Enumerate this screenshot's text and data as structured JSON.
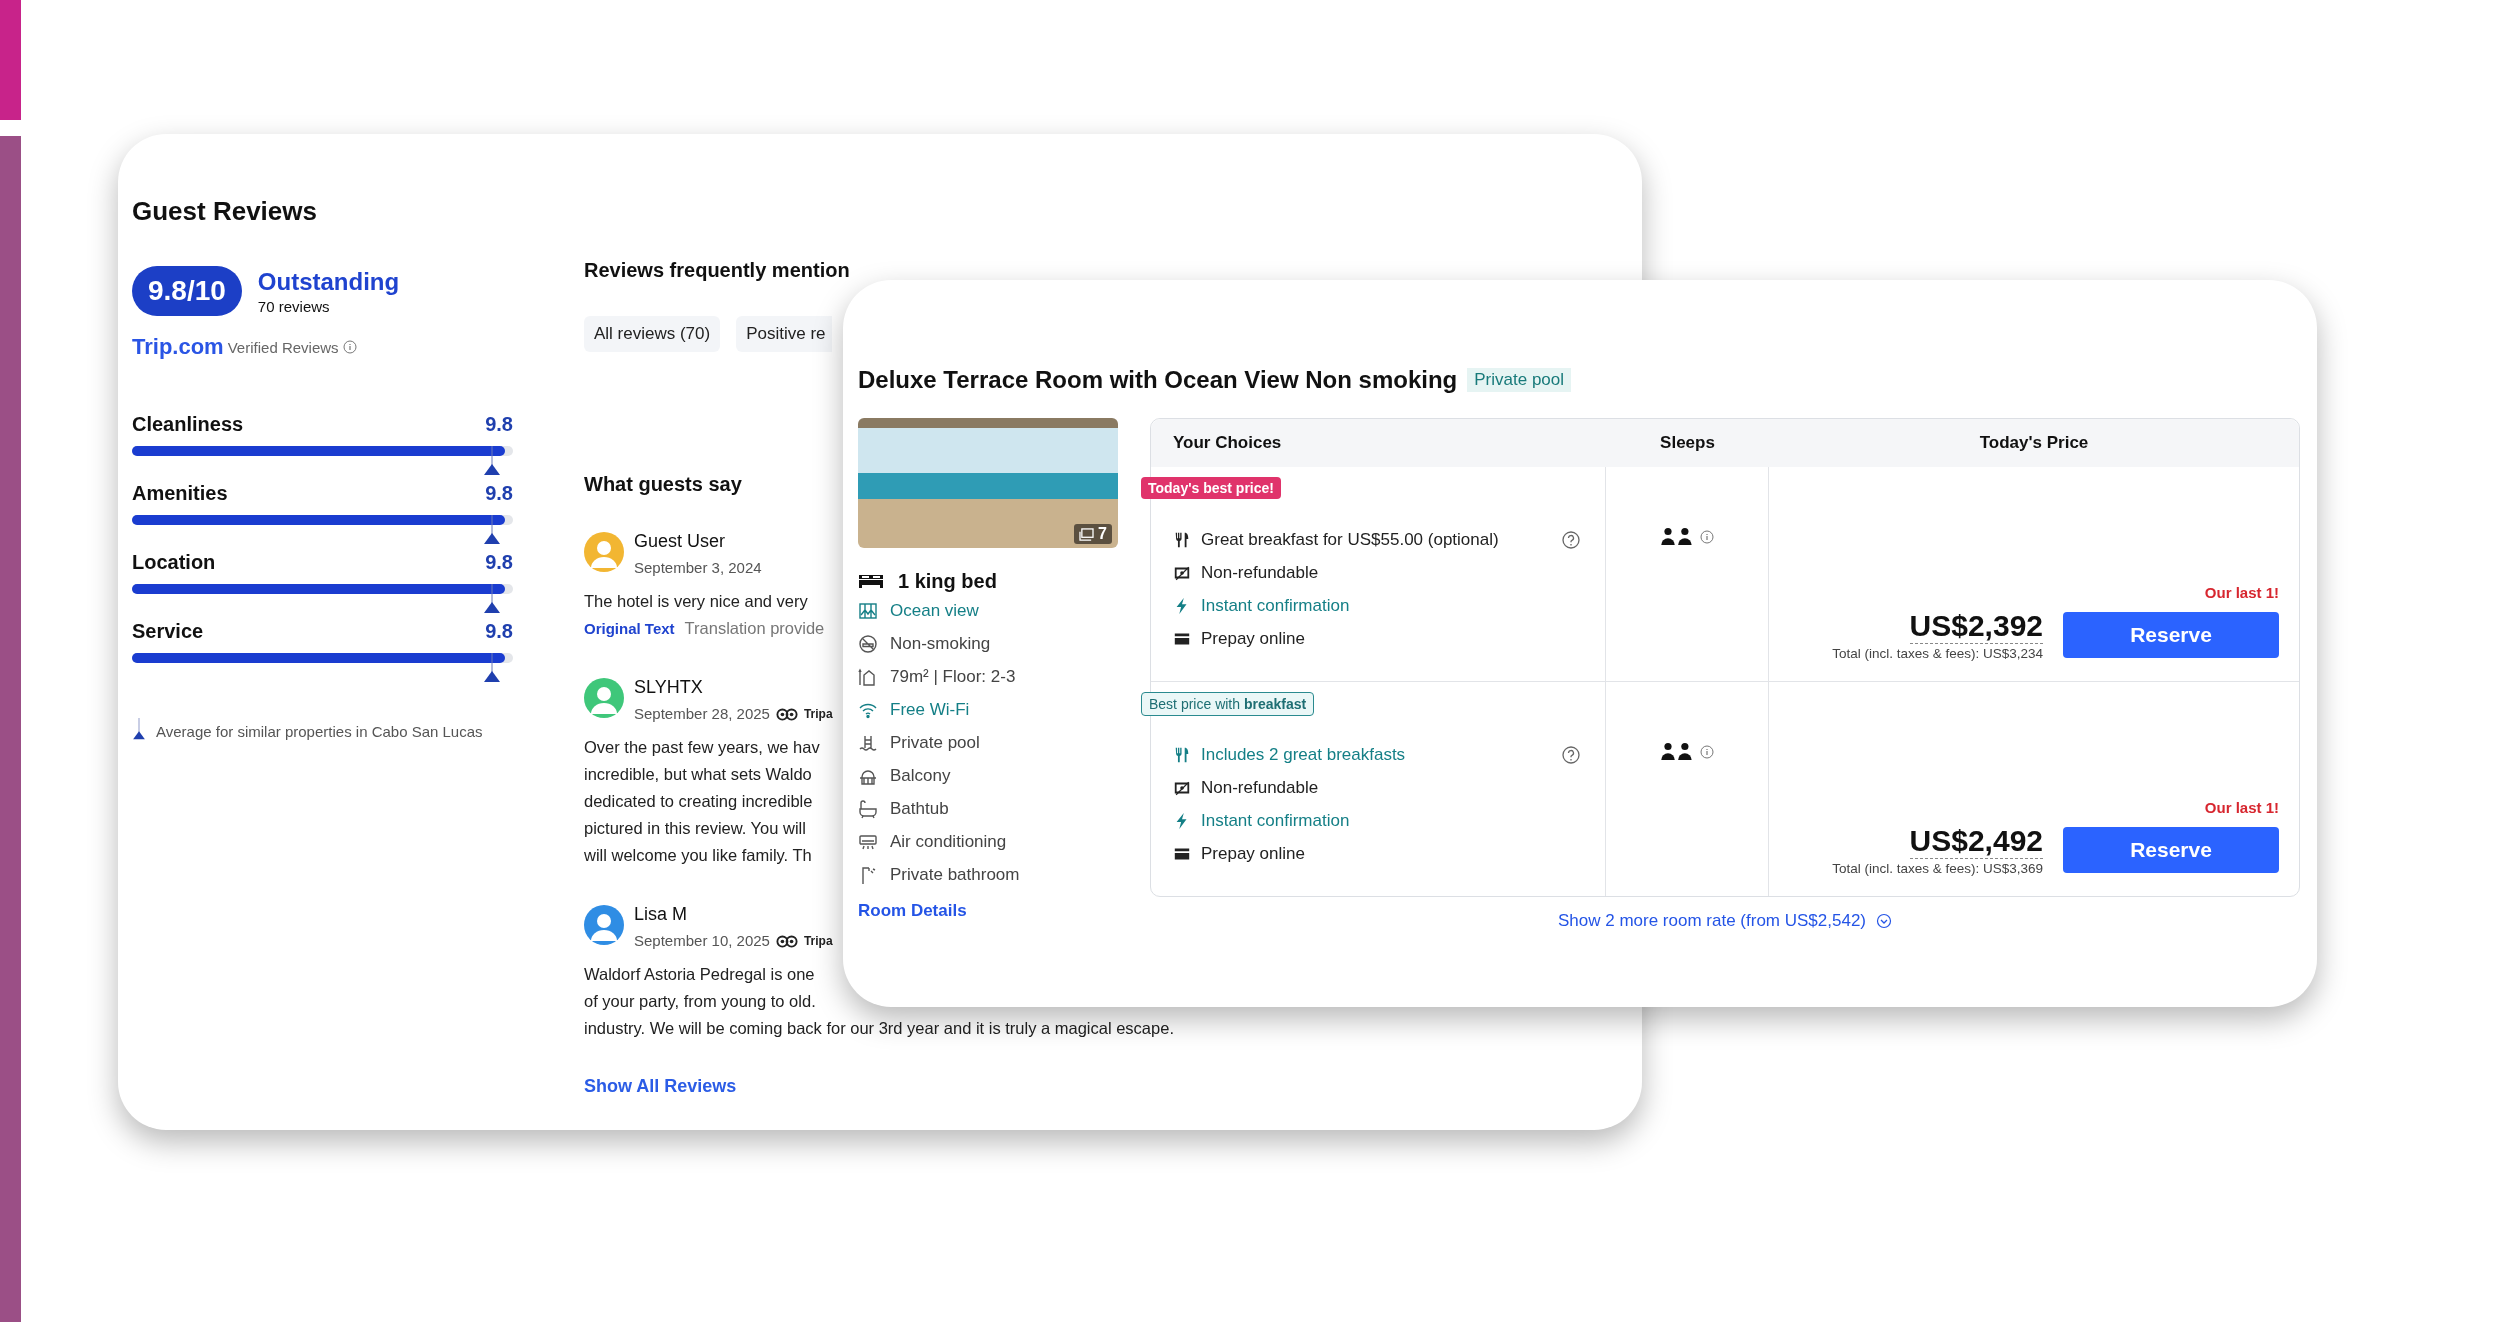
{
  "guest_reviews": {
    "title": "Guest Reviews",
    "score": "9.8/10",
    "rating_label": "Outstanding",
    "review_count": "70 reviews",
    "brand": "Trip.com",
    "verified": "Verified Reviews",
    "categories": [
      {
        "name": "Cleanliness",
        "score": "9.8",
        "level": 0.98,
        "average": {
          "level": 0.945
        }
      },
      {
        "name": "Amenities",
        "score": "9.8",
        "level": 0.98,
        "average": {
          "level": 0.945
        }
      },
      {
        "name": "Location",
        "score": "9.8",
        "level": 0.98,
        "average": {
          "level": 0.945
        }
      },
      {
        "name": "Service",
        "score": "9.8",
        "level": 0.98,
        "average": {
          "level": 0.945
        }
      }
    ],
    "average_note": "Average for similar properties in Cabo San Lucas",
    "mentions_title": "Reviews frequently mention",
    "filters": [
      "All reviews (70)",
      "Positive re"
    ],
    "guests_say_title": "What guests say",
    "reviews": [
      {
        "author": "Guest User",
        "date": "September 3, 2024",
        "color": "#f2b632",
        "lines": [
          "The hotel is very nice and very"
        ],
        "original_link": "Original Text",
        "translation_note": "Translation provide"
      },
      {
        "author": "SLYHTX",
        "date": "September 28, 2025",
        "color": "#3fc77a",
        "source": "Tripa",
        "lines": [
          "Over the past few years, we hav",
          "incredible, but what sets Waldo",
          "dedicated to creating incredible",
          "pictured in this review. You will",
          "will welcome you like family. Th"
        ]
      },
      {
        "author": "Lisa M",
        "date": "September 10, 2025",
        "color": "#2f8de4",
        "source": "Tripa",
        "lines": [
          "Waldorf Astoria Pedregal is one",
          "of your party, from young to old.",
          "industry. We will be coming back for our 3rd year and it is truly a magical escape."
        ]
      }
    ],
    "show_all": "Show All Reviews"
  },
  "room": {
    "title": "Deluxe Terrace Room with Ocean View Non smoking",
    "tag": "Private pool",
    "photo_count": "7",
    "bed": "1 king bed",
    "amenities": [
      {
        "kind": "view",
        "text": "Ocean view",
        "highlighted": true
      },
      {
        "kind": "nosmoking",
        "text": "Non-smoking",
        "highlighted": false
      },
      {
        "kind": "area",
        "text": "79m² | Floor: 2-3",
        "highlighted": false
      },
      {
        "kind": "wifi",
        "text": "Free Wi-Fi",
        "highlighted": true
      },
      {
        "kind": "pool",
        "text": "Private pool",
        "highlighted": false
      },
      {
        "kind": "balcony",
        "text": "Balcony",
        "highlighted": false
      },
      {
        "kind": "bathtub",
        "text": "Bathtub",
        "highlighted": false
      },
      {
        "kind": "ac",
        "text": "Air conditioning",
        "highlighted": false
      },
      {
        "kind": "bathroom",
        "text": "Private bathroom",
        "highlighted": false
      }
    ],
    "details_link": "Room Details",
    "columns": [
      "Your Choices",
      "Sleeps",
      "Today's Price"
    ],
    "offers": [
      {
        "tag": {
          "kind": "deal",
          "text": "Today's best price!"
        },
        "features": [
          {
            "kind": "breakfast",
            "text": "Great breakfast for US$55.00 (optional)",
            "highlighted": false,
            "help": true
          },
          {
            "kind": "nonrefund",
            "text": "Non-refundable",
            "highlighted": false,
            "help": false
          },
          {
            "kind": "instant",
            "text": "Instant confirmation",
            "highlighted": true,
            "help": false
          },
          {
            "kind": "prepay",
            "text": "Prepay online",
            "highlighted": false,
            "help": false
          }
        ],
        "last_note": "Our last 1!",
        "price": "US$2,392",
        "total": "Total (incl. taxes & fees): US$3,234",
        "button": "Reserve"
      },
      {
        "tag": {
          "kind": "breakfast",
          "text": "Best price with **breakfast**"
        },
        "features": [
          {
            "kind": "meals",
            "text": "Includes 2 great breakfasts",
            "highlighted": true,
            "help": true
          },
          {
            "kind": "nonrefund",
            "text": "Non-refundable",
            "highlighted": false,
            "help": false
          },
          {
            "kind": "instant",
            "text": "Instant confirmation",
            "highlighted": true,
            "help": false
          },
          {
            "kind": "prepay",
            "text": "Prepay online",
            "highlighted": false,
            "help": false
          }
        ],
        "last_note": "Our last 1!",
        "price": "US$2,492",
        "total": "Total (incl. taxes & fees): US$3,369",
        "button": "Reserve"
      }
    ],
    "more_rates": "Show 2 more room rate (from US$2,542)"
  }
}
